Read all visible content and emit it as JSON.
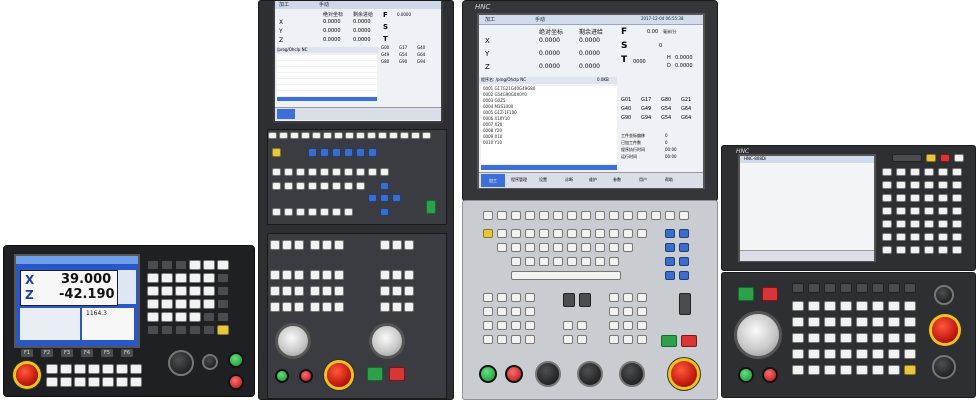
{
  "panel1": {
    "axes": [
      {
        "name": "X",
        "value": "39.000"
      },
      {
        "name": "Z",
        "value": "-42.190"
      }
    ],
    "secondary_values": [
      "1164.3"
    ],
    "fkeys": [
      "F1",
      "F2",
      "F3",
      "F4",
      "F5",
      "F6"
    ]
  },
  "panel2": {
    "tabs": [
      "加工",
      "手动"
    ],
    "col_headers": [
      "绝对坐标",
      "剩余进给"
    ],
    "axis_rows": [
      {
        "axis": "X",
        "abs": "0.0000",
        "rem": "0.0000"
      },
      {
        "axis": "Y",
        "abs": "0.0000",
        "rem": "0.0000"
      },
      {
        "axis": "Z",
        "abs": "0.0000",
        "rem": "0.0000"
      }
    ],
    "f_label": "F",
    "s_label": "S",
    "t_label": "T",
    "f_value": "0.0000",
    "program_path": "/prog/Ohclp NC",
    "gcodes": [
      "G00",
      "G17",
      "G40",
      "G49",
      "G54",
      "G64",
      "G80",
      "G90",
      "G94"
    ]
  },
  "panel3": {
    "tabs": [
      "加工",
      "手动"
    ],
    "timestamp": "2017-12-04 06:55:38",
    "col_headers": [
      "绝对坐标",
      "剩余进给"
    ],
    "axis_rows": [
      {
        "axis": "X",
        "abs": "0.0000",
        "rem": "0.0000"
      },
      {
        "axis": "Y",
        "abs": "0.0000",
        "rem": "0.0000"
      },
      {
        "axis": "Z",
        "abs": "0.0000",
        "rem": "0.0000"
      }
    ],
    "f_label": "F",
    "s_label": "S",
    "t_label": "T",
    "f_value": "0.00",
    "f_unit": "毫米/分",
    "s_value": "0",
    "t_value": "0000",
    "h_label": "H",
    "h_value": "0.0000",
    "d_label": "D",
    "d_value": "0.0000",
    "program_path": "程序名: /prog/Ohclp NC",
    "program_size": "0.0KB",
    "gcodes": [
      "G01",
      "G17",
      "G80",
      "G21",
      "G40",
      "G49",
      "G54",
      "G64",
      "G90",
      "G94",
      "G54",
      "G64"
    ],
    "code_lines": [
      "0001 G17G21G40G49G80",
      "0002 G54G90G0X0Y0",
      "0003 G0Z5",
      "0004 M3S1000",
      "0005 G1Z-1F100",
      "0006 X10Y10",
      "0007 X20",
      "0008 Y20",
      "0009 X10",
      "0010 Y10"
    ],
    "info_labels": [
      "工件坐标偏移",
      "已加工件数",
      "程序执行时间",
      "运行时间"
    ],
    "info_values": [
      "0",
      "0",
      "00:00",
      "00:00"
    ],
    "softkeys": [
      "加工",
      "程序管理",
      "设置",
      "诊断",
      "维护",
      "参数",
      "用户",
      "帮助"
    ]
  },
  "panel4": {
    "brand": "HNC",
    "screen_title": "HNC-808Di"
  },
  "colors": {
    "panel_dark": "#2d2f33",
    "panel_grey": "#c9ccd1",
    "screen_blue": "#2a57c8",
    "estop_red": "#d9261a",
    "estop_ring": "#f2c21b",
    "start_green": "#2fa04a"
  }
}
